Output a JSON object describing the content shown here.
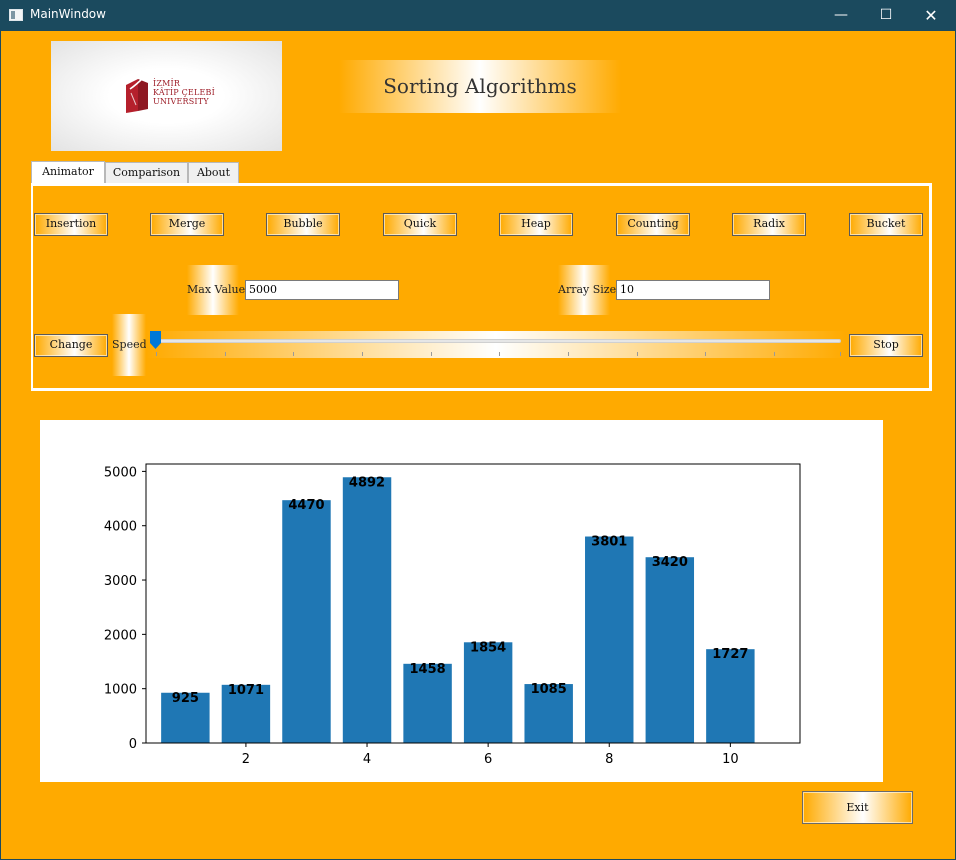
{
  "window": {
    "title": "MainWindow",
    "minimize": "—",
    "maximize": "☐",
    "close": "✕"
  },
  "logo": {
    "text_lines": [
      "İZMİR",
      "KÂTİP ÇELEBİ",
      "UNIVERSITY"
    ]
  },
  "header": {
    "title": "Sorting Algorithms"
  },
  "tabs": [
    {
      "label": "Animator",
      "active": true
    },
    {
      "label": "Comparison",
      "active": false
    },
    {
      "label": "About",
      "active": false
    }
  ],
  "algorithms": [
    "Insertion",
    "Merge",
    "Bubble",
    "Quick",
    "Heap",
    "Counting",
    "Radix",
    "Bucket"
  ],
  "inputs": {
    "max_value_label": "Max Value",
    "max_value": "5000",
    "array_size_label": "Array Size",
    "array_size": "10"
  },
  "controls": {
    "change_label": "Change",
    "speed_label": "Speed",
    "speed_value": 0,
    "stop_label": "Stop"
  },
  "footer": {
    "exit_label": "Exit"
  },
  "colors": {
    "background": "#ffaa00",
    "bar": "#1f77b4",
    "titlebar": "#1b4a5e"
  },
  "chart_data": {
    "type": "bar",
    "x": [
      1,
      2,
      3,
      4,
      5,
      6,
      7,
      8,
      9,
      10
    ],
    "values": [
      925,
      1071,
      4470,
      4892,
      1458,
      1854,
      1085,
      3801,
      3420,
      1727
    ],
    "data_labels": [
      "925",
      "1071",
      "4470",
      "4892",
      "1458",
      "1854",
      "1085",
      "3801",
      "3420",
      "1727"
    ],
    "xticks": [
      2,
      4,
      6,
      8,
      10
    ],
    "yticks": [
      0,
      1000,
      2000,
      3000,
      4000,
      5000
    ],
    "xlim": [
      0.35,
      11.15
    ],
    "ylim": [
      0,
      5136
    ],
    "title": "",
    "xlabel": "",
    "ylabel": "",
    "grid": false
  }
}
